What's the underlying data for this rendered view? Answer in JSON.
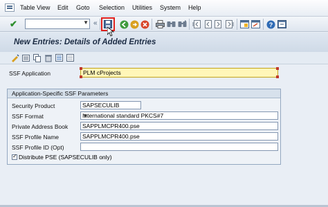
{
  "menubar": {
    "items": [
      "Table View",
      "Edit",
      "Goto",
      "Selection",
      "Utilities",
      "System",
      "Help"
    ]
  },
  "toolbar": {
    "command_value": "",
    "icons": [
      "ok-icon",
      "back-icon",
      "exit-icon",
      "cancel-icon",
      "save-icon",
      "print-icon",
      "find-icon",
      "find-next-icon",
      "first-page-icon",
      "prev-page-icon",
      "next-page-icon",
      "last-page-icon",
      "new-session-icon",
      "shortcut-icon",
      "help-icon",
      "layout-icon"
    ]
  },
  "page": {
    "title": "New Entries: Details of Added Entries"
  },
  "form": {
    "ssf_application_label": "SSF Application",
    "ssf_application_value": "PLM cProjects",
    "group_title": "Application-Specific SSF Parameters",
    "fields": [
      {
        "label": "Security Product",
        "value": "SAPSECULIB"
      },
      {
        "label": "SSF Format",
        "value": "International standard PKCS#7"
      },
      {
        "label": "Private Address Book",
        "value": "SAPPLMCPR400.pse"
      },
      {
        "label": "SSF Profile Name",
        "value": "SAPPLMCPR400.pse"
      },
      {
        "label": "SSF Profile ID (Opt)",
        "value": ""
      }
    ],
    "distribute_label": "Distribute PSE (SAPSECULIB only)",
    "distribute_checked": true
  },
  "colors": {
    "highlight": "#e0211d",
    "required_field": "#fff6b8"
  }
}
